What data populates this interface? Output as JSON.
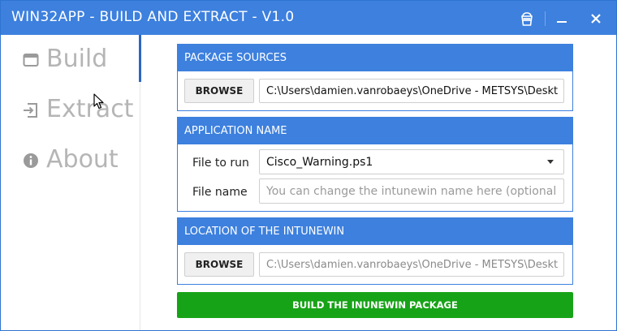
{
  "window": {
    "title": "WIN32APP - BUILD AND EXTRACT - V1.0",
    "accent_color": "#3d80de",
    "title_icons": [
      "bucket-icon",
      "minimize-icon",
      "close-icon"
    ]
  },
  "sidebar": {
    "items": [
      {
        "label": "Build",
        "icon": "window-icon",
        "active": true
      },
      {
        "label": "Extract",
        "icon": "extract-icon",
        "active": false
      },
      {
        "label": "About",
        "icon": "info-icon",
        "active": false
      }
    ]
  },
  "sources": {
    "header": "PACKAGE SOURCES",
    "browse_label": "BROWSE",
    "path_value": "C:\\Users\\damien.vanrobaeys\\OneDrive - METSYS\\Deskt"
  },
  "app_name": {
    "header": "APPLICATION NAME",
    "file_to_run_label": "File to run",
    "file_to_run_value": "Cisco_Warning.ps1",
    "file_name_label": "File name",
    "file_name_placeholder": "You can change the intunewin name here (optional)"
  },
  "location": {
    "header": "LOCATION OF THE INTUNEWIN",
    "browse_label": "BROWSE",
    "path_value": "C:\\Users\\damien.vanrobaeys\\OneDrive - METSYS\\Deskt"
  },
  "build_button": {
    "label": "BUILD THE INUNEWIN PACKAGE",
    "color": "#17a317"
  }
}
